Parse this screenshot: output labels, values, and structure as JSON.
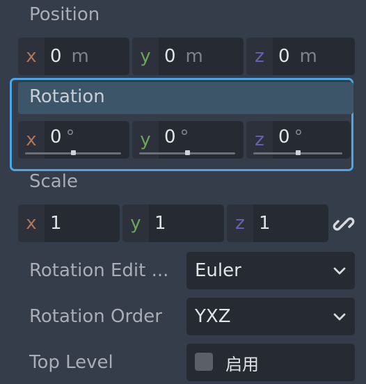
{
  "position": {
    "title": "Position",
    "x": {
      "axis": "x",
      "value": "0",
      "unit": "m"
    },
    "y": {
      "axis": "y",
      "value": "0",
      "unit": "m"
    },
    "z": {
      "axis": "z",
      "value": "0",
      "unit": "m"
    }
  },
  "rotation": {
    "title": "Rotation",
    "x": {
      "axis": "x",
      "value": "0",
      "unit": "°",
      "slider_fraction": 0.5
    },
    "y": {
      "axis": "y",
      "value": "0",
      "unit": "°",
      "slider_fraction": 0.5
    },
    "z": {
      "axis": "z",
      "value": "0",
      "unit": "°",
      "slider_fraction": 0.5
    }
  },
  "scale": {
    "title": "Scale",
    "x": {
      "axis": "x",
      "value": "1"
    },
    "y": {
      "axis": "y",
      "value": "1"
    },
    "z": {
      "axis": "z",
      "value": "1"
    },
    "link_icon": "chain-link-icon"
  },
  "rotation_edit_mode": {
    "label": "Rotation Edit ...",
    "value": "Euler"
  },
  "rotation_order": {
    "label": "Rotation Order",
    "value": "YXZ"
  },
  "top_level": {
    "label": "Top Level",
    "checkbox_label": "启用",
    "checked": false
  },
  "colors": {
    "background": "#363d4a",
    "field": "#262a33",
    "accent": "#4ca6e4",
    "axis_x": "#b07658",
    "axis_y": "#6ba45a",
    "axis_z": "#6b61b3"
  }
}
